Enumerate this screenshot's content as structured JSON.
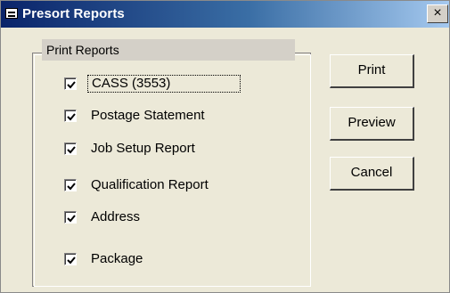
{
  "window": {
    "title": "Presort Reports",
    "close_glyph": "×"
  },
  "group": {
    "legend": "Print Reports",
    "options": [
      {
        "label": "CASS (3553)",
        "checked": true,
        "focused": true
      },
      {
        "label": "Postage Statement",
        "checked": true
      },
      {
        "label": "Job Setup Report",
        "checked": true
      },
      {
        "label": "Qualification Report",
        "checked": true
      },
      {
        "label": "Address",
        "checked": true
      },
      {
        "label": "Package",
        "checked": true
      }
    ]
  },
  "buttons": {
    "print": "Print",
    "preview": "Preview",
    "cancel": "Cancel"
  },
  "icons": {
    "title": "form-icon",
    "check": "checkmark-icon"
  }
}
